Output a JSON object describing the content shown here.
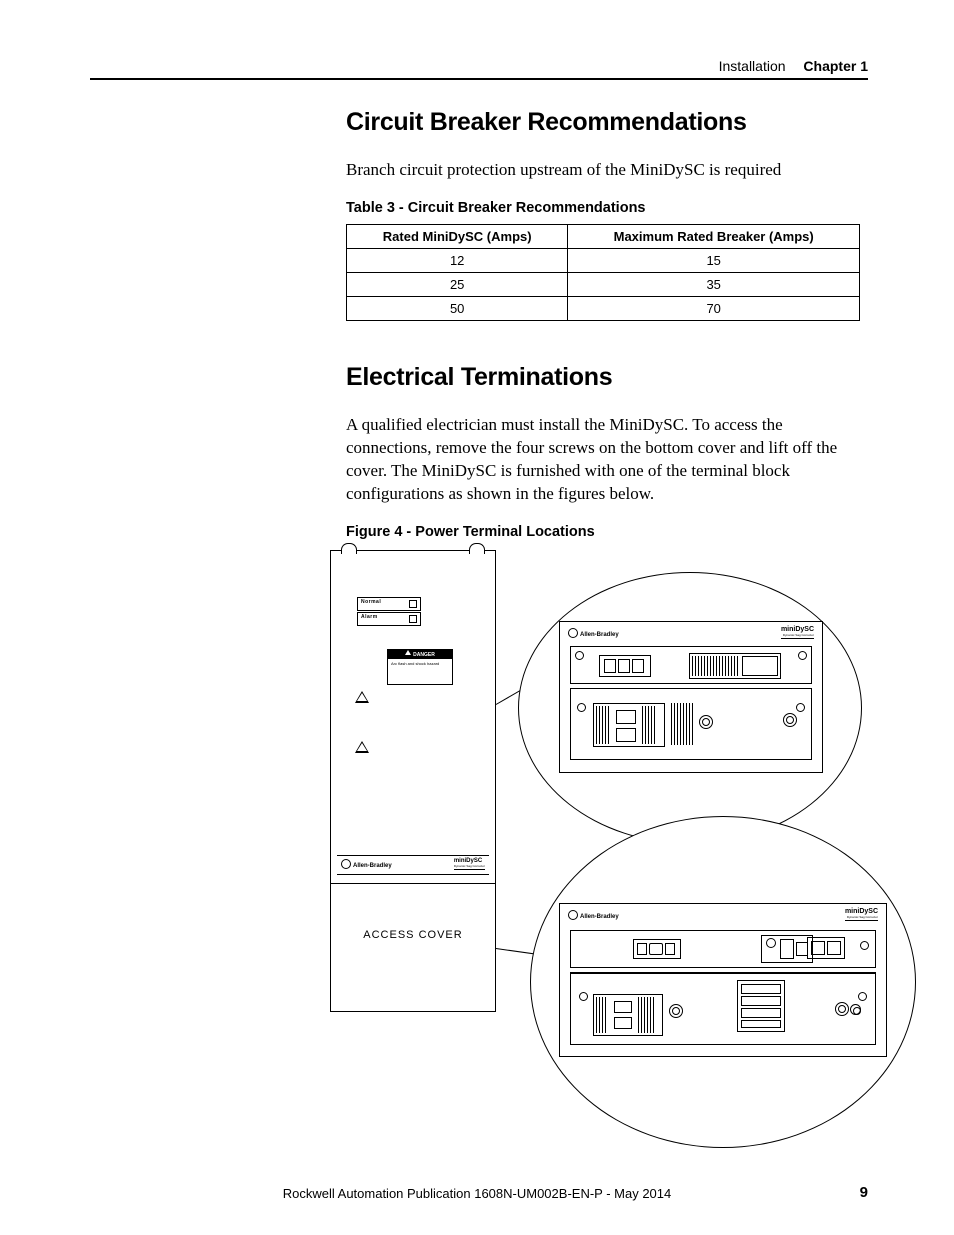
{
  "header": {
    "section": "Installation",
    "chapter": "Chapter 1"
  },
  "s1": {
    "title": "Circuit Breaker Recommendations",
    "intro": "Branch circuit protection upstream of the MiniDySC is required",
    "table_caption": "Table 3 - Circuit Breaker Recommendations",
    "table": {
      "col1": "Rated MiniDySC (Amps)",
      "col2": "Maximum Rated Breaker (Amps)",
      "rows": [
        {
          "a": "12",
          "b": "15"
        },
        {
          "a": "25",
          "b": "35"
        },
        {
          "a": "50",
          "b": "70"
        }
      ]
    }
  },
  "s2": {
    "title": "Electrical Terminations",
    "body": "A qualified electrician must install the MiniDySC. To access the connections, remove the four screws on the bottom cover and lift off the cover. The MiniDySC is furnished with one of the terminal block configurations as shown in the figures below.",
    "figure_caption": "Figure 4 - Power Terminal Locations",
    "access_cover": "ACCESS COVER",
    "brand": "Allen-Bradley",
    "product": "miniDySC",
    "product_sub": "Dynamic Sag Corrector",
    "danger_title": "DANGER",
    "danger_text": "Arc flash and shock hazard"
  },
  "footer": {
    "pub": "Rockwell Automation Publication 1608N-UM002B-EN-P - May 2014",
    "page": "9"
  }
}
